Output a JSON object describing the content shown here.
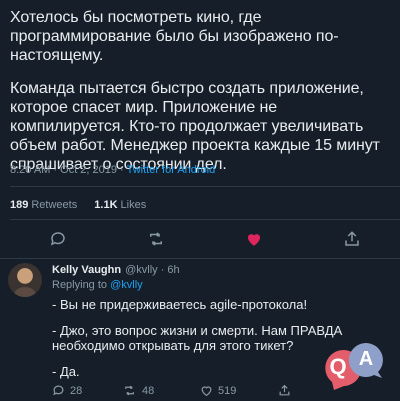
{
  "tweet": {
    "paragraph_1": "Хотелось бы посмотреть кино, где программирование было бы изображено по-настоящему.",
    "paragraph_2": "Команда пытается быстро создать приложение, которое спасет мир. Приложение не компилируется. Кто-то продолжает увеличивать объем работ. Менеджер проекта каждые 15 минут спрашивает о состоянии дел.",
    "time": "8:20 AM · Oct 2, 2019 · ",
    "client": "Twitter for Android",
    "retweets_count": "189",
    "retweets_label": "Retweets",
    "likes_count": "1.1K",
    "likes_label": "Likes"
  },
  "actions": {
    "reply_icon": "comment-icon",
    "retweet_icon": "retweet-icon",
    "like_icon": "heart-icon",
    "share_icon": "share-icon",
    "like_color": "#e0245e"
  },
  "reply": {
    "name": "Kelly Vaughn",
    "meta": "@kvlly · 6h",
    "replying_prefix": "Replying to ",
    "replying_handle": "@kvlly",
    "line_1": "- Вы не придерживаетесь agile-протокола!",
    "line_2": "- Джо, это вопрос жизни и смерти. Нам ПРАВДА необходимо открывать для этого тикет?",
    "line_3": "- Да.",
    "reply_count": "28",
    "retweet_count": "48",
    "like_count": "519"
  },
  "watermark": {
    "q": "Q",
    "a": "A",
    "q_color": "#e35d6a",
    "a_color": "#8e9fc9"
  }
}
